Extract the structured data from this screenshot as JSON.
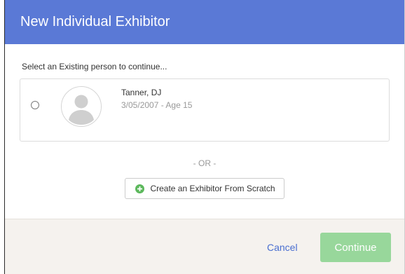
{
  "modal": {
    "title": "New Individual Exhibitor",
    "prompt": "Select an Existing person to continue...",
    "person": {
      "name": "Tanner, DJ",
      "meta": "3/05/2007 - Age 15",
      "avatar_icon": "person-silhouette-icon",
      "selected": false
    },
    "or_label": "- OR -",
    "scratch_button": {
      "label": "Create an Exhibitor From Scratch",
      "icon": "plus-circle-icon"
    },
    "footer": {
      "cancel_label": "Cancel",
      "continue_label": "Continue"
    }
  },
  "colors": {
    "header": "#5a79d6",
    "continue": "#98d79b",
    "cancel_link": "#4a6fd0",
    "plus_icon": "#5cb85c",
    "footer_bg": "#f5f2ee"
  }
}
